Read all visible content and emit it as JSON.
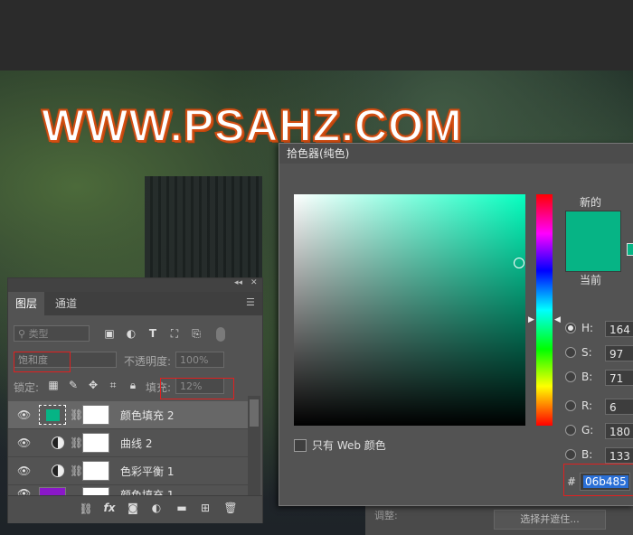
{
  "watermark": "WWW.PSAHZ.COM",
  "layers_panel": {
    "collapse_glyph": "◂◂",
    "close_glyph": "✕",
    "menu_glyph": "☰",
    "tabs": [
      {
        "label": "图层",
        "active": true
      },
      {
        "label": "通道",
        "active": false
      }
    ],
    "filter_kind": "类型",
    "blend_mode": "饱和度",
    "opacity_label": "不透明度:",
    "opacity_value": "100%",
    "lock_label": "锁定:",
    "fill_label": "填充:",
    "fill_value": "12%",
    "layers": [
      {
        "name": "颜色填充 2",
        "selected": true,
        "thumb_color": "#06b485",
        "icon": "color-fill"
      },
      {
        "name": "曲线 2",
        "selected": false,
        "icon": "adjustment"
      },
      {
        "name": "色彩平衡 1",
        "selected": false,
        "icon": "adjustment"
      },
      {
        "name": "颜色填充 1",
        "selected": false,
        "thumb_color": "#8a18c8",
        "icon": "color-fill"
      }
    ],
    "bottom_icons": [
      "link-icon",
      "fx-icon",
      "mask-icon",
      "adjustment-icon",
      "folder-icon",
      "new-layer-icon",
      "trash-icon"
    ],
    "fx_label": "fx"
  },
  "color_picker": {
    "title": "拾色器(纯色)",
    "new_label": "新的",
    "current_label": "当前",
    "swatch_color": "#06b485",
    "only_web_label": "只有 Web 颜色",
    "hsb": {
      "h_label": "H:",
      "h": "164",
      "s_label": "S:",
      "s": "97",
      "b_label": "B:",
      "b": "71"
    },
    "rgb": {
      "r_label": "R:",
      "r": "6",
      "g_label": "G:",
      "g": "180",
      "b_label": "B:",
      "b": "133"
    },
    "hex_label": "#",
    "hex": "06b485",
    "selected_mode": "H"
  },
  "background_dialog": {
    "adjust_label": "调整:",
    "button_label": "选择并遮住..."
  },
  "colors": {
    "accent_red": "#e02020",
    "watermark_fill": "#ffffff",
    "watermark_stroke": "#d24e12",
    "selection_blue": "#2a6fd6"
  }
}
